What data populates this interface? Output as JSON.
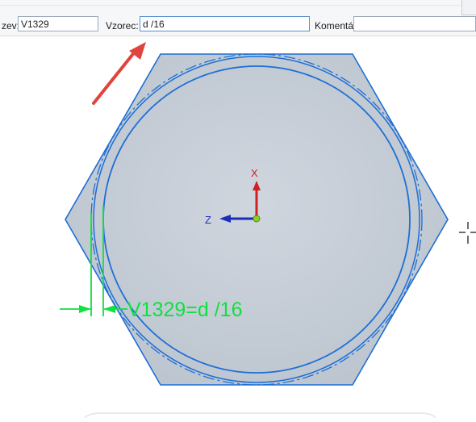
{
  "toolbar": {
    "name_label": "zev:",
    "name_value": "V1329",
    "formula_label": "Vzorec:",
    "formula_value": "d /16",
    "comment_label": "Komentář:",
    "comment_value": ""
  },
  "canvas": {
    "axis_x_label": "X",
    "axis_z_label": "Z",
    "dimension_text": "V1329=d /16"
  },
  "colors": {
    "part_fill": "#c4ccd6",
    "edge_blue": "#1c6fd6",
    "dimension_green": "#10e040",
    "arrow_red": "#e0443c"
  }
}
